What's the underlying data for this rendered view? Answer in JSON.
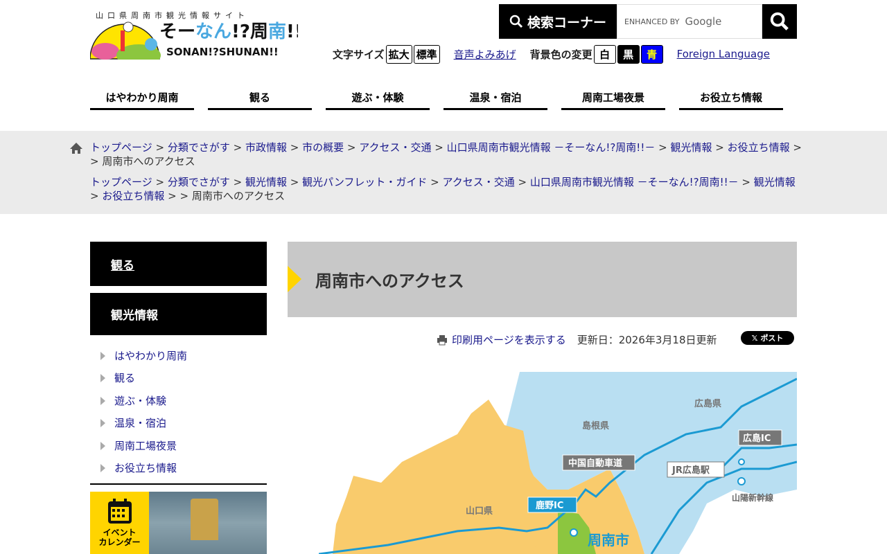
{
  "header": {
    "logo_tagline": "山口県周南市観光情報サイト",
    "logo_text": "そーなん!?周南!!",
    "logo_romaji": "SONAN!?SHUNAN!!",
    "search_label": "検索コーナー",
    "search_placeholder_prefix": "ENHANCED BY",
    "search_placeholder_brand": "Google",
    "font_size_label": "文字サイズ",
    "font_enlarge": "拡大",
    "font_standard": "標準",
    "speech": "音声よみあげ",
    "bg_label": "背景色の変更",
    "bg_white": "白",
    "bg_black": "黒",
    "bg_blue": "青",
    "foreign": "Foreign Language"
  },
  "nav": [
    "はやわかり周南",
    "観る",
    "遊ぶ・体験",
    "温泉・宿泊",
    "周南工場夜景",
    "お役立ち情報"
  ],
  "breadcrumbs": [
    {
      "links": [
        "トップページ",
        "分類でさがす",
        "市政情報",
        "市の概要",
        "アクセス・交通",
        "山口県周南市観光情報 －そーなん!?周南!!－",
        "観光情報",
        "お役立ち情報"
      ],
      "current": "周南市へのアクセス"
    },
    {
      "links": [
        "トップページ",
        "分類でさがす",
        "観光情報",
        "観光パンフレット・ガイド",
        "アクセス・交通",
        "山口県周南市観光情報 －そーなん!?周南!!－",
        "観光情報",
        "お役立ち情報",
        ""
      ],
      "current": "周南市へのアクセス"
    }
  ],
  "sidebar": {
    "heading1": "観る",
    "heading2": "観光情報",
    "items": [
      "はやわかり周南",
      "観る",
      "遊ぶ・体験",
      "温泉・宿泊",
      "周南工場夜景",
      "お役立ち情報"
    ],
    "event_banner": "イベント\nカレンダー"
  },
  "main": {
    "title": "周南市へのアクセス",
    "print": "印刷用ページを表示する",
    "updated": "更新日：2026年3月18日更新",
    "post": "ポスト"
  },
  "map": {
    "labels": {
      "hiroshima_pref": "広島県",
      "shimane_pref": "島根県",
      "yamaguchi_pref": "山口県",
      "chugoku_expressway": "中国自動車道",
      "hiroshima_ic": "広島IC",
      "jr_hiroshima": "JR広島駅",
      "sanyo_shinkansen": "山陽新幹線",
      "kano_ic": "鹿野IC",
      "shunan": "周南市"
    }
  }
}
